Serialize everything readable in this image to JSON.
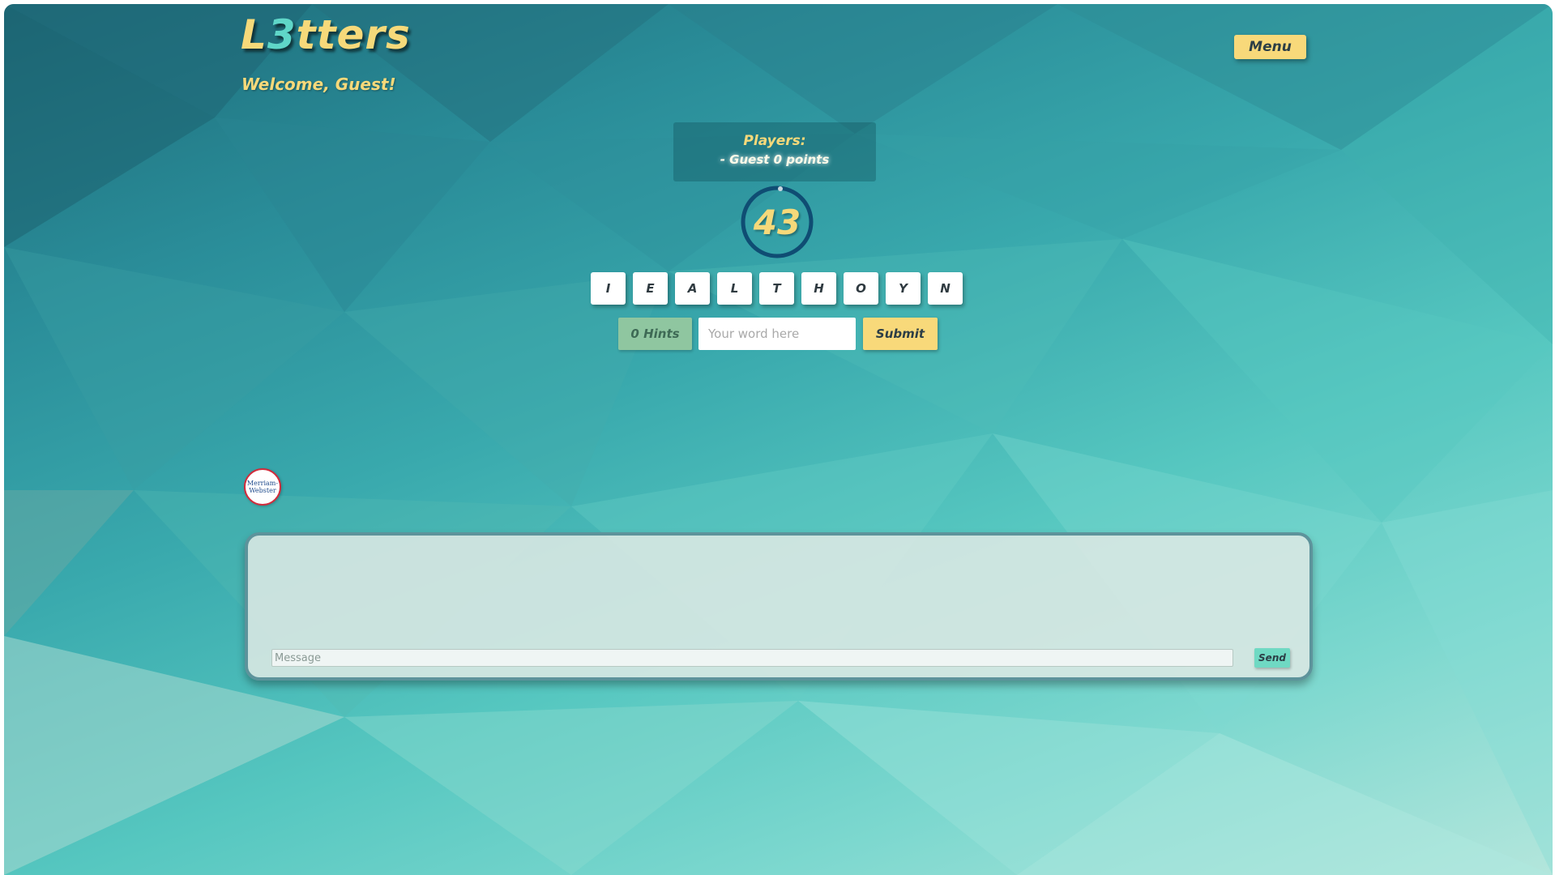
{
  "app": {
    "logo_prefix": "L",
    "logo_digit": "3",
    "logo_suffix": "tters",
    "welcome": "Welcome, Guest!",
    "menu_label": "Menu"
  },
  "players": {
    "title": "Players:",
    "entries": [
      "- Guest 0 points"
    ]
  },
  "timer": {
    "seconds": "43"
  },
  "letters": [
    "I",
    "E",
    "A",
    "L",
    "T",
    "H",
    "O",
    "Y",
    "N"
  ],
  "controls": {
    "hints_label": "0 Hints",
    "word_placeholder": "Your word here",
    "submit_label": "Submit"
  },
  "dictionary": {
    "logo_line1": "Merriam-",
    "logo_line2": "Webster"
  },
  "chat": {
    "message_placeholder": "Message",
    "send_label": "Send"
  },
  "colors": {
    "accent_yellow": "#f8d97a",
    "teal_dark": "#1d6b79",
    "teal_light": "#7dd8cf",
    "timer_ring": "#0f4d73",
    "chat_border": "#5d939b",
    "send_button": "#6fd9c3"
  }
}
